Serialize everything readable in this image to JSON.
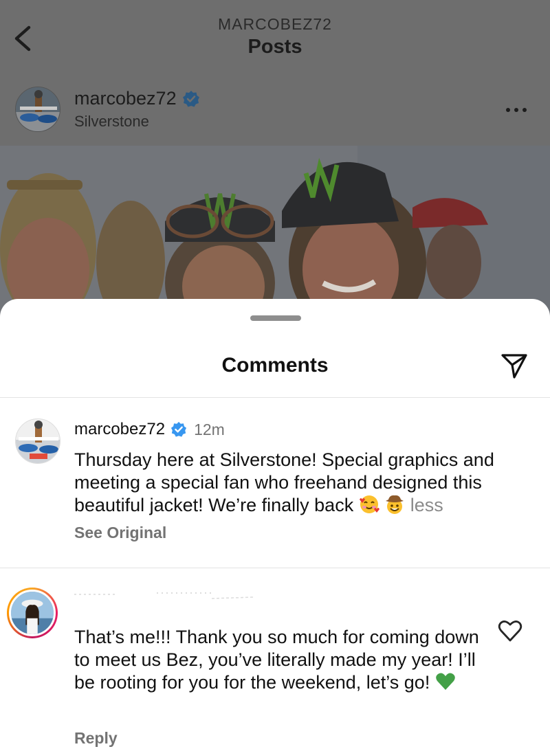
{
  "header": {
    "username_caps": "MARCOBEZ72",
    "title": "Posts"
  },
  "post": {
    "username": "marcobez72",
    "location": "Silverstone"
  },
  "sheet": {
    "title": "Comments"
  },
  "caption": {
    "username": "marcobez72",
    "time": "12m",
    "text": "Thursday here at Silverstone! Special graphics and meeting a special fan who freehand designed this beautiful jacket! We’re finally back",
    "less_label": "less",
    "action_label": "See Original"
  },
  "reply_comment": {
    "text": "That’s me!!! Thank you so much for coming down to meet us Bez, you’ve literally made my year! I’ll be rooting for you for the weekend, let’s go!",
    "action_label": "Reply"
  },
  "icons": {
    "back": "chevron-left-icon",
    "more": "more-horizontal-icon",
    "share": "paper-plane-icon",
    "verified": "verified-badge-icon",
    "like": "heart-outline-icon"
  },
  "colors": {
    "verified_blue": "#3897f0",
    "muted_text": "#737373",
    "sheet_bg": "#ffffff"
  }
}
